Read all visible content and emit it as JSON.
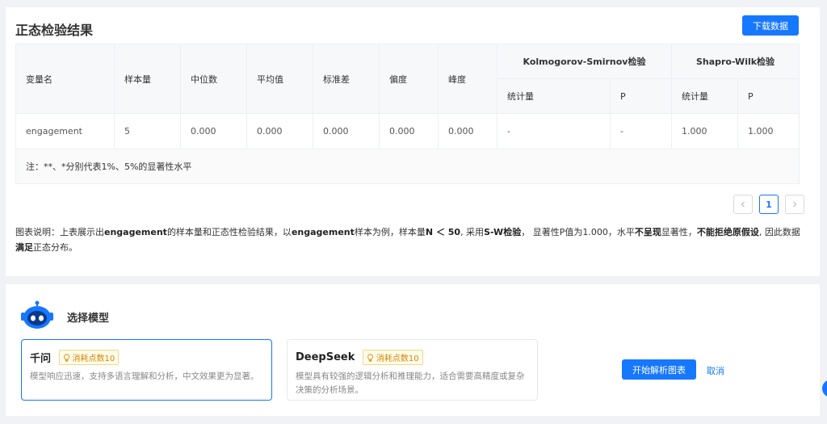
{
  "result": {
    "title": "正态检验结果",
    "download_label": "下载数据",
    "table": {
      "headers": {
        "variable": "变量名",
        "sample_size": "样本量",
        "median": "中位数",
        "mean": "平均值",
        "std": "标准差",
        "skewness": "偏度",
        "kurtosis": "峰度",
        "ks_group": "Kolmogorov-Smirnov检验",
        "sw_group": "Shapro-Wilk检验",
        "ks_stat": "统计量",
        "ks_p": "P",
        "sw_stat": "统计量",
        "sw_p": "P"
      },
      "row": {
        "variable": "engagement",
        "sample_size": "5",
        "median": "0.000",
        "mean": "0.000",
        "std": "0.000",
        "skewness": "0.000",
        "kurtosis": "0.000",
        "ks_stat": "-",
        "ks_p": "-",
        "sw_stat": "1.000",
        "sw_p": "1.000"
      },
      "note": "注：**、*分别代表1%、5%的显著性水平"
    },
    "pagination": {
      "prev_icon": "chevron-left-icon",
      "page": "1",
      "next_icon": "chevron-right-icon"
    },
    "description": {
      "p1": "图表说明：上表展示出",
      "b1": "engagement",
      "p2": "的样本量和正态性检验结果，以",
      "b2": "engagement",
      "p3": "样本为例，样本量",
      "b3": "N ＜ 50",
      "p4": ", 采用",
      "b4": "S-W检验",
      "p5": "， 显著性P值为1.000，水平",
      "b5": "不呈现",
      "p6": "显著性，",
      "b6": "不能拒绝原假设",
      "p7": ", 因此数据",
      "b7": "满足",
      "p8": "正态分布。"
    }
  },
  "model_select": {
    "title": "选择模型",
    "robot_icon": "robot-icon",
    "models": [
      {
        "name": "千问",
        "badge": "消耗点数10",
        "desc": "模型响应迅速，支持多语言理解和分析，中文效果更为显著。",
        "selected": true
      },
      {
        "name": "DeepSeek",
        "badge": "消耗点数10",
        "desc": "模型具有较强的逻辑分析和推理能力，适合需要高精度或复杂决策的分析场景。",
        "selected": false
      }
    ],
    "start_label": "开始解析图表",
    "cancel_label": "取消"
  },
  "colors": {
    "primary": "#1677ff",
    "badge_text": "#d48806",
    "badge_bg": "#fffbe8"
  }
}
